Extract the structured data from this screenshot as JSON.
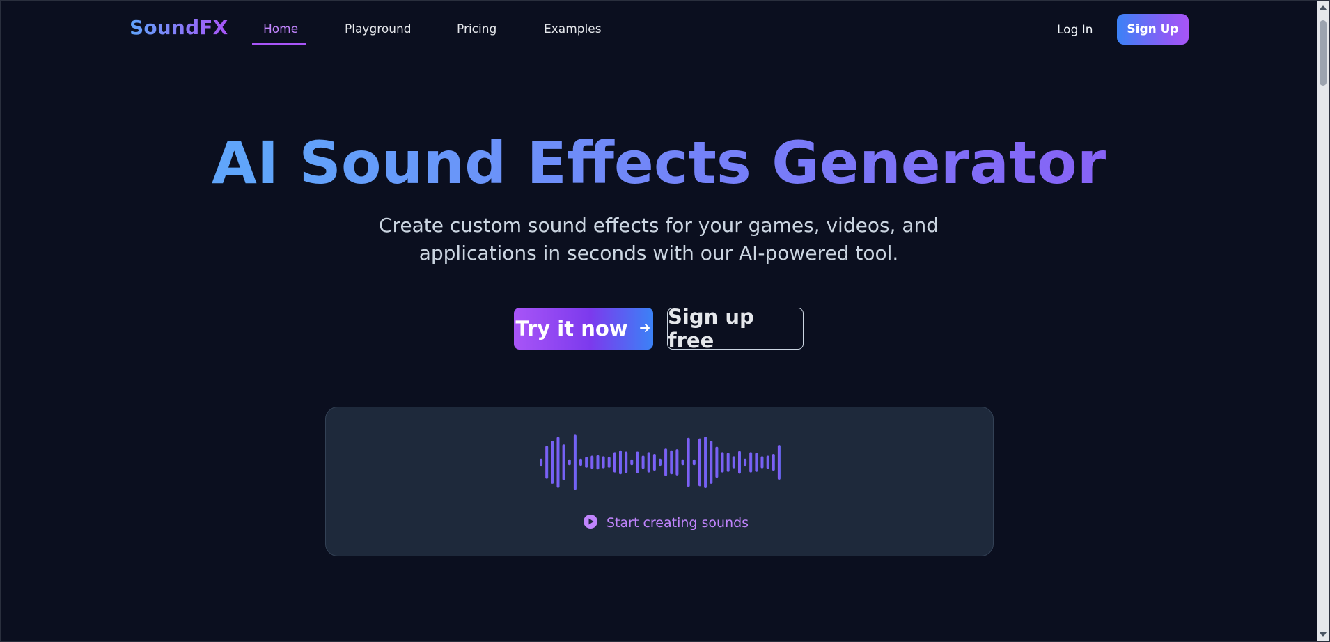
{
  "nav": {
    "logo": "SoundFX",
    "links": [
      {
        "label": "Home",
        "active": true
      },
      {
        "label": "Playground",
        "active": false
      },
      {
        "label": "Pricing",
        "active": false
      },
      {
        "label": "Examples",
        "active": false
      }
    ],
    "login_label": "Log In",
    "signup_label": "Sign Up"
  },
  "hero": {
    "title": "AI Sound Effects Generator",
    "subtitle": "Create custom sound effects for your games, videos, and applications in seconds with our AI-powered tool.",
    "primary_cta": "Try it now",
    "primary_cta_icon": "arrow-right-icon",
    "secondary_cta": "Sign up free"
  },
  "demo": {
    "waveform_levels": [
      0.12,
      0.55,
      0.72,
      0.85,
      0.6,
      0.1,
      0.92,
      0.12,
      0.18,
      0.22,
      0.24,
      0.2,
      0.18,
      0.34,
      0.4,
      0.36,
      0.1,
      0.36,
      0.22,
      0.34,
      0.28,
      0.12,
      0.46,
      0.4,
      0.44,
      0.1,
      0.82,
      0.1,
      0.8,
      0.86,
      0.72,
      0.52,
      0.34,
      0.32,
      0.2,
      0.38,
      0.12,
      0.34,
      0.32,
      0.2,
      0.22,
      0.28,
      0.58
    ],
    "start_label": "Start creating sounds",
    "start_icon": "play-circle-icon"
  },
  "colors": {
    "background": "#0b0f1f",
    "card": "#1e293b",
    "accent_purple": "#a855f7",
    "accent_blue": "#3b82f6"
  }
}
